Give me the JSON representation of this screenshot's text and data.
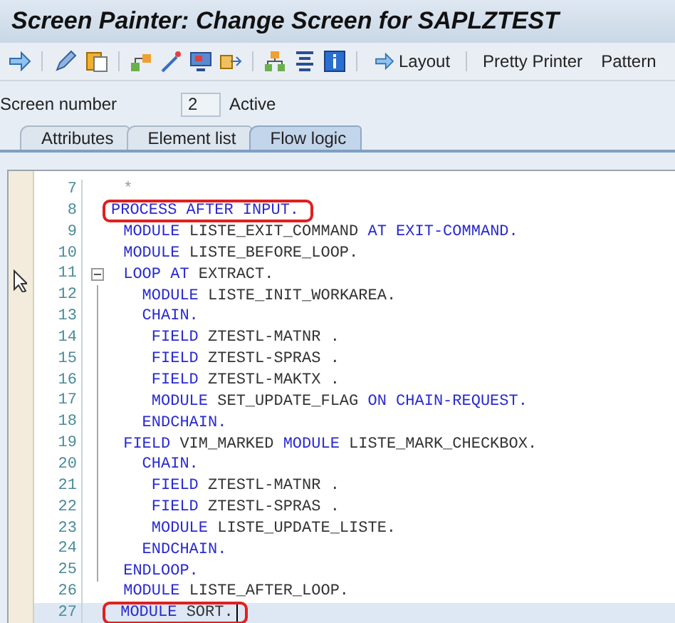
{
  "window": {
    "title": "Screen Painter: Change Screen for SAPLZTEST"
  },
  "toolbar": {
    "buttons": [
      {
        "label": "Layout",
        "kind": "icon-text"
      },
      {
        "label": "Pretty Printer",
        "kind": "text"
      },
      {
        "label": "Pattern",
        "kind": "text"
      }
    ]
  },
  "screen": {
    "label": "Screen number",
    "value": "2",
    "status": "Active"
  },
  "tabs": [
    {
      "label": "Attributes",
      "selected": false
    },
    {
      "label": "Element list",
      "selected": false
    },
    {
      "label": "Flow logic",
      "selected": true
    }
  ],
  "editor": {
    "lines": [
      {
        "number": "7",
        "tokens": [
          {
            "text": " *",
            "kind": "comment"
          }
        ]
      },
      {
        "number": "8",
        "marked": true,
        "tokens": [
          {
            "text": "PROCESS AFTER INPUT.",
            "kind": "keyword"
          }
        ]
      },
      {
        "number": "9",
        "tokens": [
          {
            "text": " MODULE",
            "kind": "keyword"
          },
          {
            "text": " LISTE_EXIT_COMMAND ",
            "kind": "plain"
          },
          {
            "text": "AT EXIT-COMMAND.",
            "kind": "keyword"
          }
        ]
      },
      {
        "number": "10",
        "tokens": [
          {
            "text": " MODULE",
            "kind": "keyword"
          },
          {
            "text": " LISTE_BEFORE_LOOP.",
            "kind": "plain"
          }
        ]
      },
      {
        "number": "11",
        "fold": true,
        "tokens": [
          {
            "text": " LOOP AT",
            "kind": "keyword"
          },
          {
            "text": " EXTRACT.",
            "kind": "plain"
          }
        ]
      },
      {
        "number": "12",
        "in_block": true,
        "tokens": [
          {
            "text": "   MODULE",
            "kind": "keyword"
          },
          {
            "text": " LISTE_INIT_WORKAREA.",
            "kind": "plain"
          }
        ]
      },
      {
        "number": "13",
        "in_block": true,
        "tokens": [
          {
            "text": "   CHAIN.",
            "kind": "keyword"
          }
        ]
      },
      {
        "number": "14",
        "in_block": true,
        "tokens": [
          {
            "text": "    FIELD",
            "kind": "keyword"
          },
          {
            "text": " ZTESTL-MATNR .",
            "kind": "plain"
          }
        ]
      },
      {
        "number": "15",
        "in_block": true,
        "tokens": [
          {
            "text": "    FIELD",
            "kind": "keyword"
          },
          {
            "text": " ZTESTL-SPRAS .",
            "kind": "plain"
          }
        ]
      },
      {
        "number": "16",
        "in_block": true,
        "tokens": [
          {
            "text": "    FIELD",
            "kind": "keyword"
          },
          {
            "text": " ZTESTL-MAKTX .",
            "kind": "plain"
          }
        ]
      },
      {
        "number": "17",
        "in_block": true,
        "tokens": [
          {
            "text": "    MODULE",
            "kind": "keyword"
          },
          {
            "text": " SET_UPDATE_FLAG ",
            "kind": "plain"
          },
          {
            "text": "ON CHAIN-REQUEST.",
            "kind": "keyword"
          }
        ]
      },
      {
        "number": "18",
        "in_block": true,
        "tokens": [
          {
            "text": "   ENDCHAIN.",
            "kind": "keyword"
          }
        ]
      },
      {
        "number": "19",
        "in_block": true,
        "tokens": [
          {
            "text": " FIELD",
            "kind": "keyword"
          },
          {
            "text": " VIM_MARKED ",
            "kind": "plain"
          },
          {
            "text": "MODULE",
            "kind": "keyword"
          },
          {
            "text": " LISTE_MARK_CHECKBOX.",
            "kind": "plain"
          }
        ]
      },
      {
        "number": "20",
        "in_block": true,
        "tokens": [
          {
            "text": "   CHAIN.",
            "kind": "keyword"
          }
        ]
      },
      {
        "number": "21",
        "in_block": true,
        "tokens": [
          {
            "text": "    FIELD",
            "kind": "keyword"
          },
          {
            "text": " ZTESTL-MATNR .",
            "kind": "plain"
          }
        ]
      },
      {
        "number": "22",
        "in_block": true,
        "tokens": [
          {
            "text": "    FIELD",
            "kind": "keyword"
          },
          {
            "text": " ZTESTL-SPRAS .",
            "kind": "plain"
          }
        ]
      },
      {
        "number": "23",
        "in_block": true,
        "tokens": [
          {
            "text": "    MODULE",
            "kind": "keyword"
          },
          {
            "text": " LISTE_UPDATE_LISTE.",
            "kind": "plain"
          }
        ]
      },
      {
        "number": "24",
        "in_block": true,
        "tokens": [
          {
            "text": "   ENDCHAIN.",
            "kind": "keyword"
          }
        ]
      },
      {
        "number": "25",
        "in_block": true,
        "tokens": [
          {
            "text": " ENDLOOP.",
            "kind": "keyword"
          }
        ]
      },
      {
        "number": "26",
        "tokens": [
          {
            "text": " MODULE",
            "kind": "keyword"
          },
          {
            "text": " LISTE_AFTER_LOOP.",
            "kind": "plain"
          }
        ]
      },
      {
        "number": "27",
        "marked": true,
        "current": true,
        "tokens": [
          {
            "text": " MODULE",
            "kind": "keyword"
          },
          {
            "text": " SORT.",
            "kind": "plain"
          }
        ]
      }
    ]
  }
}
